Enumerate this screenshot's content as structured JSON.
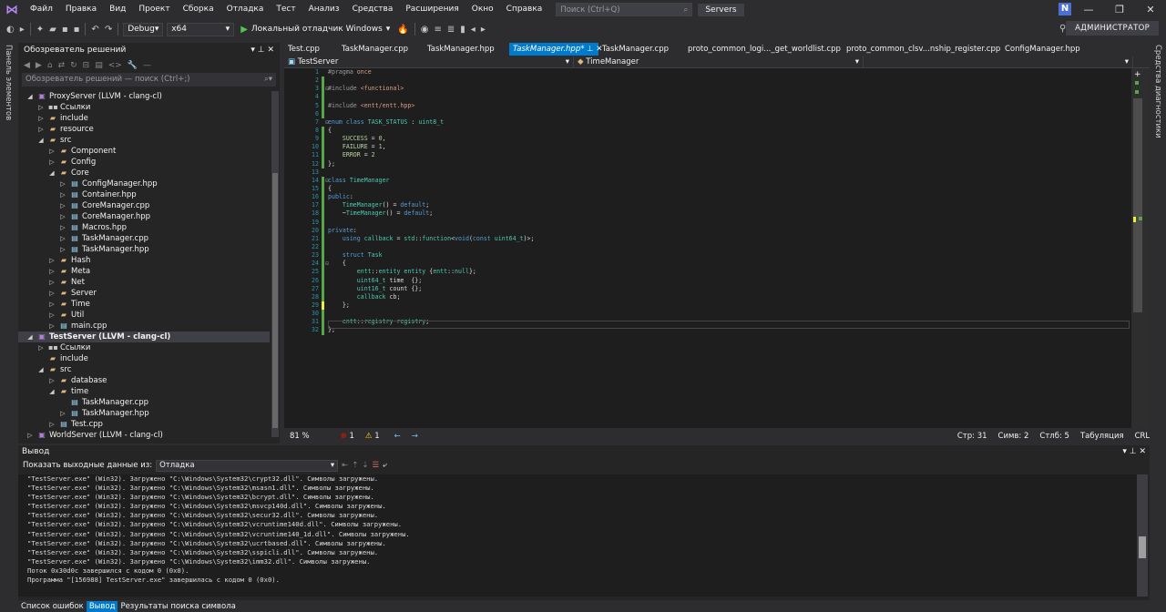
{
  "menu": {
    "items": [
      "Файл",
      "Правка",
      "Вид",
      "Проект",
      "Сборка",
      "Отладка",
      "Тест",
      "Анализ",
      "Средства",
      "Расширения",
      "Окно",
      "Справка"
    ],
    "search_placeholder": "Поиск (Ctrl+Q)",
    "solution_name": "Servers",
    "user_initial": "N"
  },
  "toolbar": {
    "config": "Debug",
    "platform": "x64",
    "run_label": "Локальный отладчик Windows",
    "admin_label": "АДМИНИСТРАТОР"
  },
  "left_strip_label": "Панель элементов",
  "right_strip_label": "Средства диагностики",
  "solution_explorer": {
    "title": "Обозреватель решений",
    "search_placeholder": "Обозреватель решений — поиск (Ctrl+;)",
    "tree": [
      {
        "label": "ProxyServer (LLVM - clang-cl)",
        "depth": 0,
        "type": "proj",
        "arrow": "down"
      },
      {
        "label": "Ссылки",
        "depth": 1,
        "type": "ref",
        "arrow": "right"
      },
      {
        "label": "include",
        "depth": 1,
        "type": "folder",
        "arrow": "right"
      },
      {
        "label": "resource",
        "depth": 1,
        "type": "folder",
        "arrow": "right"
      },
      {
        "label": "src",
        "depth": 1,
        "type": "folder",
        "arrow": "down"
      },
      {
        "label": "Component",
        "depth": 2,
        "type": "folder",
        "arrow": "right"
      },
      {
        "label": "Config",
        "depth": 2,
        "type": "folder",
        "arrow": "right"
      },
      {
        "label": "Core",
        "depth": 2,
        "type": "folder",
        "arrow": "down"
      },
      {
        "label": "ConfigManager.hpp",
        "depth": 3,
        "type": "file",
        "arrow": "right"
      },
      {
        "label": "Container.hpp",
        "depth": 3,
        "type": "file",
        "arrow": "right"
      },
      {
        "label": "CoreManager.cpp",
        "depth": 3,
        "type": "file",
        "arrow": "right"
      },
      {
        "label": "CoreManager.hpp",
        "depth": 3,
        "type": "file",
        "arrow": "right"
      },
      {
        "label": "Macros.hpp",
        "depth": 3,
        "type": "file",
        "arrow": "right"
      },
      {
        "label": "TaskManager.cpp",
        "depth": 3,
        "type": "file",
        "arrow": "right"
      },
      {
        "label": "TaskManager.hpp",
        "depth": 3,
        "type": "file",
        "arrow": "right"
      },
      {
        "label": "Hash",
        "depth": 2,
        "type": "folder",
        "arrow": "right"
      },
      {
        "label": "Meta",
        "depth": 2,
        "type": "folder",
        "arrow": "right"
      },
      {
        "label": "Net",
        "depth": 2,
        "type": "folder",
        "arrow": "right"
      },
      {
        "label": "Server",
        "depth": 2,
        "type": "folder",
        "arrow": "right"
      },
      {
        "label": "Time",
        "depth": 2,
        "type": "folder",
        "arrow": "right"
      },
      {
        "label": "Util",
        "depth": 2,
        "type": "folder",
        "arrow": "right"
      },
      {
        "label": "main.cpp",
        "depth": 2,
        "type": "file",
        "arrow": "right"
      },
      {
        "label": "TestServer (LLVM - clang-cl)",
        "depth": 0,
        "type": "proj",
        "arrow": "down",
        "selected": true
      },
      {
        "label": "Ссылки",
        "depth": 1,
        "type": "ref",
        "arrow": "right"
      },
      {
        "label": "include",
        "depth": 1,
        "type": "folder",
        "arrow": ""
      },
      {
        "label": "src",
        "depth": 1,
        "type": "folder",
        "arrow": "down"
      },
      {
        "label": "database",
        "depth": 2,
        "type": "folder",
        "arrow": "right"
      },
      {
        "label": "time",
        "depth": 2,
        "type": "folder",
        "arrow": "down"
      },
      {
        "label": "TaskManager.cpp",
        "depth": 3,
        "type": "file",
        "arrow": ""
      },
      {
        "label": "TaskManager.hpp",
        "depth": 3,
        "type": "file",
        "arrow": "right"
      },
      {
        "label": "Test.cpp",
        "depth": 2,
        "type": "file",
        "arrow": "right"
      },
      {
        "label": "WorldServer (LLVM - clang-cl)",
        "depth": 0,
        "type": "proj",
        "arrow": "right"
      }
    ]
  },
  "tabs": [
    "Test.cpp",
    "TaskManager.cpp",
    "TaskManager.hpp",
    "TaskManager.hpp*",
    "TaskManager.cpp",
    "proto_common_logi..._get_worldlist.cpp",
    "proto_common_clsv...nship_register.cpp",
    "ConfigManager.hpp"
  ],
  "active_tab": 3,
  "navbar": {
    "project": "TestServer",
    "scope": "TimeManager"
  },
  "code_lines": [
    "#pragma once",
    "",
    "#include <functional>",
    "",
    "#include <entt/entt.hpp>",
    "",
    "enum class TASK_STATUS : uint8_t",
    "{",
    "    SUCCESS = 0,",
    "    FAILURE = 1,",
    "    ERROR = 2",
    "};",
    "",
    "class TimeManager",
    "{",
    "public:",
    "    TimeManager() = default;",
    "    ~TimeManager() = default;",
    "",
    "private:",
    "    using callback = std::function<void(const uint64_t)>;",
    "",
    "    struct Task",
    "    {",
    "        entt::entity entity {entt::null};",
    "        uint64_t time  {};",
    "        uint16_t count {};",
    "        callback cb;",
    "    };",
    "",
    "    entt::registry registry;",
    "};"
  ],
  "editor_status": {
    "zoom": "81 %",
    "errors": "1",
    "warnings": "1",
    "line": "Стр: 31",
    "chars": "Симв: 2",
    "col": "Стлб: 5",
    "tabs": "Табуляция",
    "eol": "CRLF"
  },
  "output": {
    "title": "Вывод",
    "show_from_label": "Показать выходные данные из:",
    "source": "Отладка",
    "lines": [
      "\"TestServer.exe\" (Win32). Загружено \"C:\\Windows\\System32\\crypt32.dll\". Символы загружены.",
      "\"TestServer.exe\" (Win32). Загружено \"C:\\Windows\\System32\\msasn1.dll\". Символы загружены.",
      "\"TestServer.exe\" (Win32). Загружено \"C:\\Windows\\System32\\bcrypt.dll\". Символы загружены.",
      "\"TestServer.exe\" (Win32). Загружено \"C:\\Windows\\System32\\msvcp140d.dll\". Символы загружены.",
      "\"TestServer.exe\" (Win32). Загружено \"C:\\Windows\\System32\\secur32.dll\". Символы загружены.",
      "\"TestServer.exe\" (Win32). Загружено \"C:\\Windows\\System32\\vcruntime140d.dll\". Символы загружены.",
      "\"TestServer.exe\" (Win32). Загружено \"C:\\Windows\\System32\\vcruntime140_1d.dll\". Символы загружены.",
      "\"TestServer.exe\" (Win32). Загружено \"C:\\Windows\\System32\\ucrtbased.dll\". Символы загружены.",
      "\"TestServer.exe\" (Win32). Загружено \"C:\\Windows\\System32\\sspicli.dll\". Символы загружены.",
      "\"TestServer.exe\" (Win32). Загружено \"C:\\Windows\\System32\\imm32.dll\". Символы загружены.",
      "Поток 0x30d0c завершился с кодом 0 (0x0).",
      "Программа \"[156988] TestServer.exe\" завершилась с кодом 0 (0x0)."
    ]
  },
  "bottom_tabs": [
    "Список ошибок",
    "Вывод",
    "Результаты поиска символа"
  ],
  "bottom_active": 1
}
